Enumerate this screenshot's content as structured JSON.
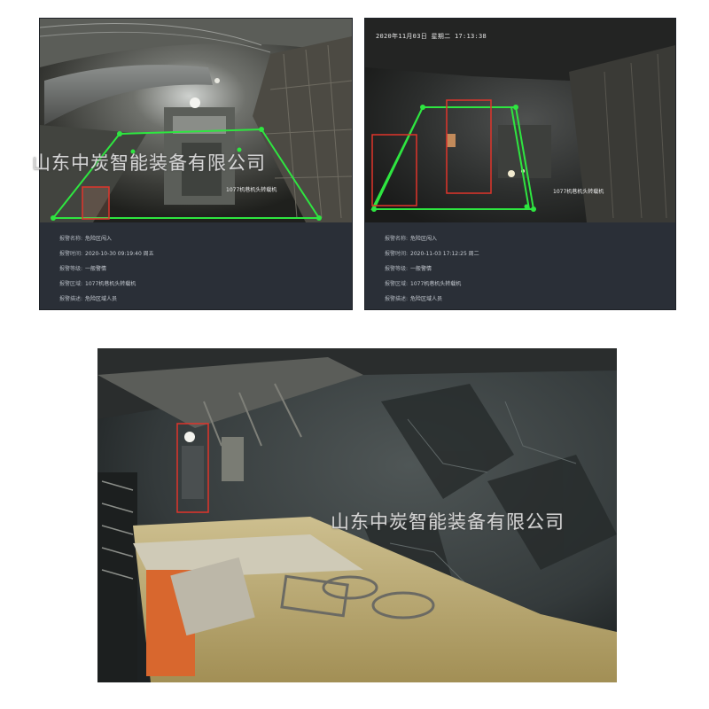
{
  "watermark": "山东中炭智能装备有限公司",
  "panel_left": {
    "timestamp": "",
    "zone_label": "1077机巷机头转载机",
    "info": [
      {
        "label": "报警名称:",
        "value": "危险区闯入"
      },
      {
        "label": "报警时间:",
        "value": "2020-10-30 09:19:40 周五"
      },
      {
        "label": "报警等级:",
        "value": "一般警情"
      },
      {
        "label": "报警区域:",
        "value": "1077机巷机头转载机"
      },
      {
        "label": "报警描述:",
        "value": "危险区域人员"
      }
    ]
  },
  "panel_right": {
    "timestamp": "2020年11月03日 星期二 17:13:38",
    "zone_label": "1077机巷机头转载机",
    "info": [
      {
        "label": "报警名称:",
        "value": "危险区闯入"
      },
      {
        "label": "报警时间:",
        "value": "2020-11-03 17:12:25 周二"
      },
      {
        "label": "报警等级:",
        "value": "一般警情"
      },
      {
        "label": "报警区域:",
        "value": "1077机巷机头转载机"
      },
      {
        "label": "报警描述:",
        "value": "危险区域人员"
      }
    ]
  },
  "colors": {
    "zone_line": "#2ee640",
    "person_box": "#e0352b",
    "panel_bg": "#2a2f37"
  }
}
